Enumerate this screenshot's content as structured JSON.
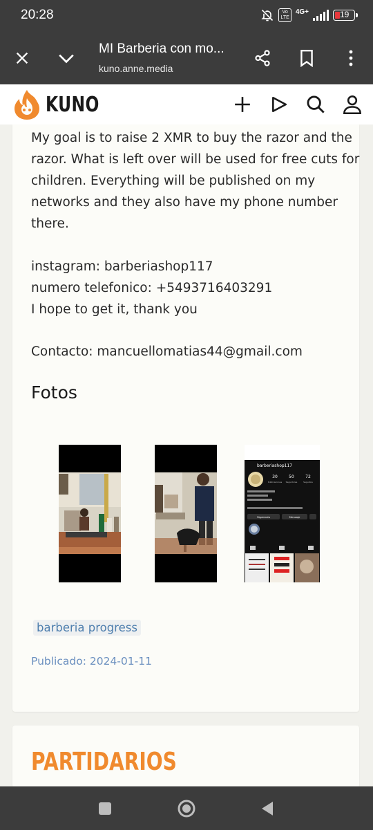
{
  "status_bar": {
    "time": "20:28",
    "network": "4G+",
    "volte_top": "Vo",
    "volte_bottom": "LTE",
    "battery": "19",
    "battery_color": "#e8383d"
  },
  "browser": {
    "title": "MI Barberia con mo...",
    "url": "kuno.anne.media",
    "icons": [
      "close-icon",
      "chevron-down-icon",
      "share-icon",
      "bookmark-icon",
      "more-vert-icon"
    ]
  },
  "site": {
    "logo_text": "KUNO",
    "brand_color": "#f08a2e",
    "icons": [
      "plus-icon",
      "play-icon",
      "search-icon",
      "user-icon"
    ]
  },
  "article": {
    "paragraph1_lines": [
      "My goal is to raise 2 XMR to buy the razor and the",
      "razor. What is left over will be used for free cuts for",
      "children. Everything will be published on my",
      "networks and they also have my phone number",
      "there."
    ],
    "instagram": "instagram: barberiashop117",
    "phone": "numero telefonico: +5493716403291",
    "closing": "I hope to get it, thank you",
    "contact": "Contacto: mancuellomatias44@gmail.com"
  },
  "photos": {
    "heading": "Fotos",
    "screenshot": {
      "username": "barberiashop117",
      "stats": [
        {
          "value": "30",
          "label": "Publicaciones"
        },
        {
          "value": "50",
          "label": "Seguidores"
        },
        {
          "value": "72",
          "label": "Seguidos"
        }
      ],
      "following_label": "Siguiendo",
      "message_label": "Mensaje"
    }
  },
  "tag": "barberia progress",
  "published": {
    "label": "Publicado:",
    "date": "2024-01-11"
  },
  "supporters": {
    "heading": "PARTIDARIOS"
  },
  "nav": {
    "icons": [
      "recents-icon",
      "home-icon",
      "back-icon"
    ]
  }
}
